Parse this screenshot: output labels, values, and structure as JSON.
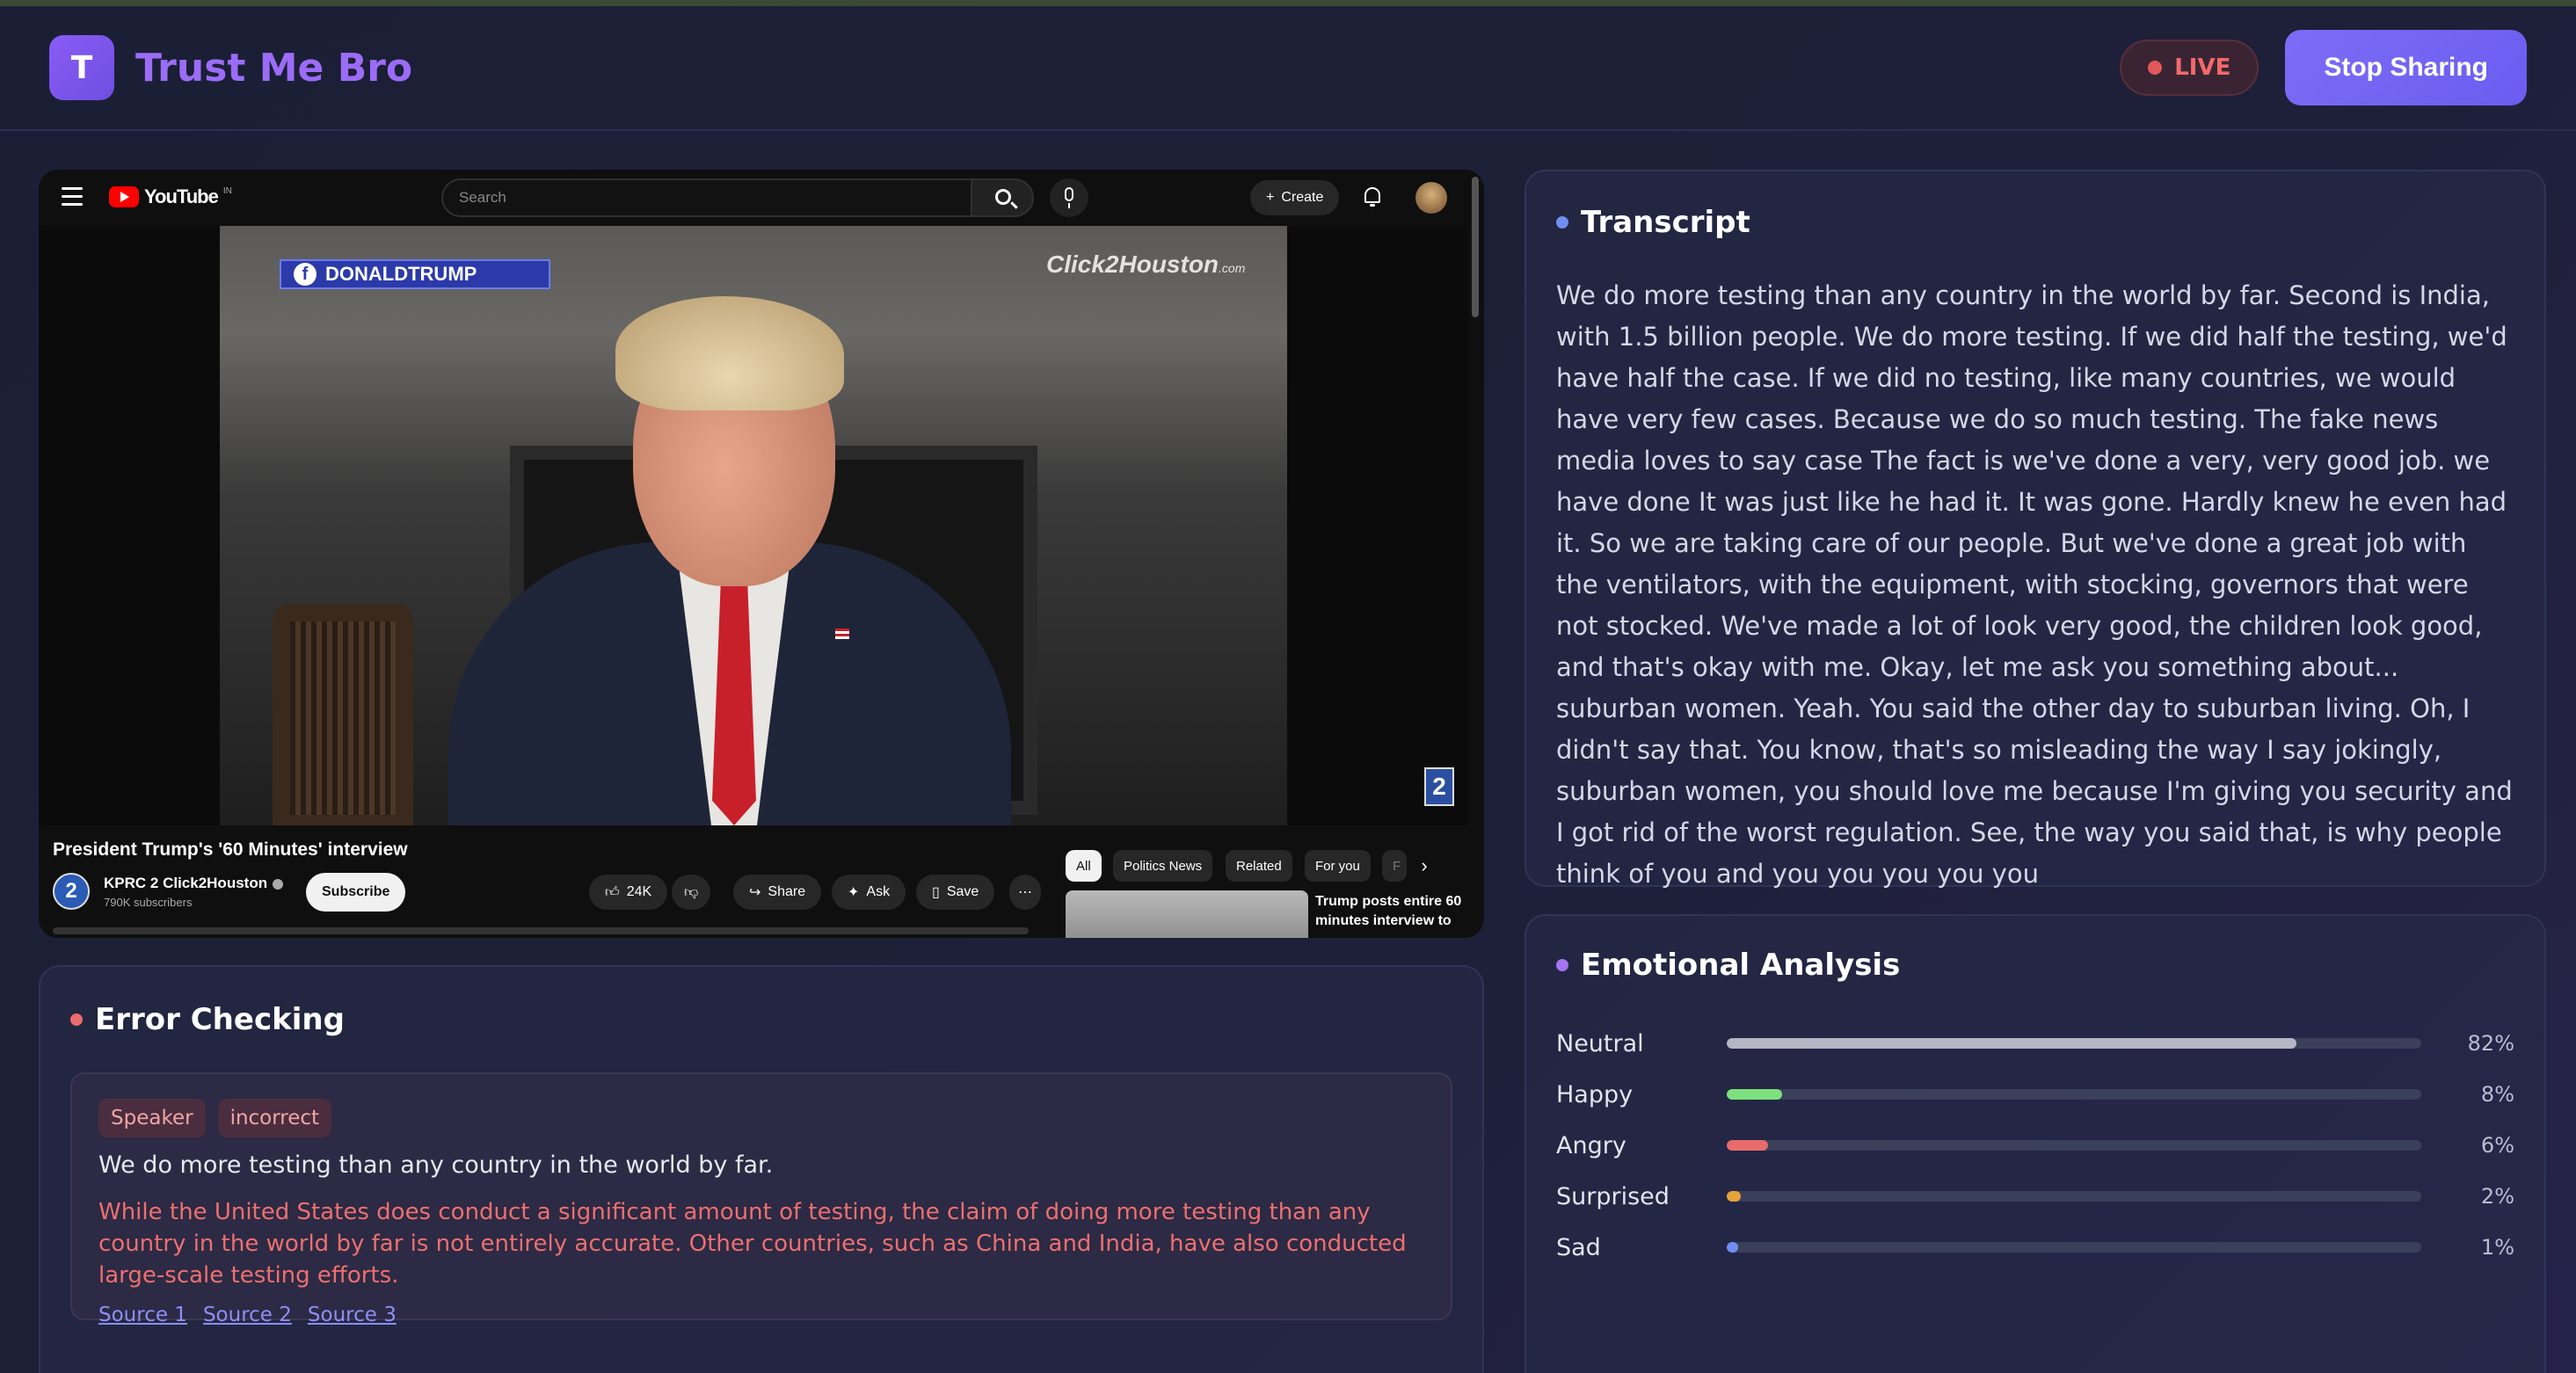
{
  "header": {
    "logo_letter": "T",
    "app_title": "Trust Me Bro",
    "live_label": "LIVE",
    "stop_button": "Stop Sharing"
  },
  "video": {
    "yt_logo": "YouTube",
    "yt_region": "IN",
    "search_placeholder": "Search",
    "create_label": "Create",
    "overlay_banner": "DONALDTRUMP",
    "overlay_brand": "Click2Houston",
    "overlay_brand_suffix": ".com",
    "title": "President Trump's '60 Minutes' interview",
    "channel_name": "KPRC 2 Click2Houston",
    "subscribers": "790K subscribers",
    "subscribe_label": "Subscribe",
    "likes": "24K",
    "share_label": "Share",
    "ask_label": "Ask",
    "save_label": "Save",
    "chips": [
      "All",
      "Politics News",
      "Related",
      "For you",
      "F"
    ],
    "recommendation_title": "Trump posts entire 60 minutes interview to"
  },
  "transcript": {
    "title": "Transcript",
    "text": " We do more testing than any country in the world by far. Second is India, with 1.5 billion people. We do more testing. If we did half the testing, we'd have half the case. If we did no testing, like many countries, we would have very few cases. Because we do so much testing. The fake news media loves to say case The fact is we've done a very, very good job. we have done It was just like he had it. It was gone. Hardly knew he even had it. So we are taking care of our people. But we've done a great job with the ventilators, with the equipment, with stocking, governors that were not stocked. We've made a lot of look very good, the children look good, and that's okay with me. Okay, let me ask you something about... suburban women. Yeah. You said the other day to suburban living. Oh, I didn't say that. You know, that's so misleading the way I say jokingly, suburban women, you should love me because I'm giving you security and I got rid of the worst regulation. See, the way you said that, is why people think of you and you you you you you"
  },
  "error_checking": {
    "title": "Error Checking",
    "badges": [
      "Speaker",
      "incorrect"
    ],
    "claim": "We do more testing than any country in the world by far.",
    "explanation": "While the United States does conduct a significant amount of testing, the claim of doing more testing than any country in the world by far is not entirely accurate. Other countries, such as China and India, have also conducted large-scale testing efforts.",
    "sources": [
      "Source 1",
      "Source 2",
      "Source 3"
    ]
  },
  "emotional_analysis": {
    "title": "Emotional Analysis",
    "emotions": [
      {
        "label": "Neutral",
        "value": 82,
        "display": "82%",
        "color": "#b4b6c3"
      },
      {
        "label": "Happy",
        "value": 8,
        "display": "8%",
        "color": "#7ee07e"
      },
      {
        "label": "Angry",
        "value": 6,
        "display": "6%",
        "color": "#e86c6c"
      },
      {
        "label": "Surprised",
        "value": 2,
        "display": "2%",
        "color": "#e8a23a"
      },
      {
        "label": "Sad",
        "value": 1,
        "display": "1%",
        "color": "#6f8ef0"
      }
    ]
  },
  "colors": {
    "accent": "#7d6cf6",
    "transcript_dot": "#6f8ef0",
    "error_dot": "#e86c6c",
    "emotion_dot": "#a874f0"
  }
}
